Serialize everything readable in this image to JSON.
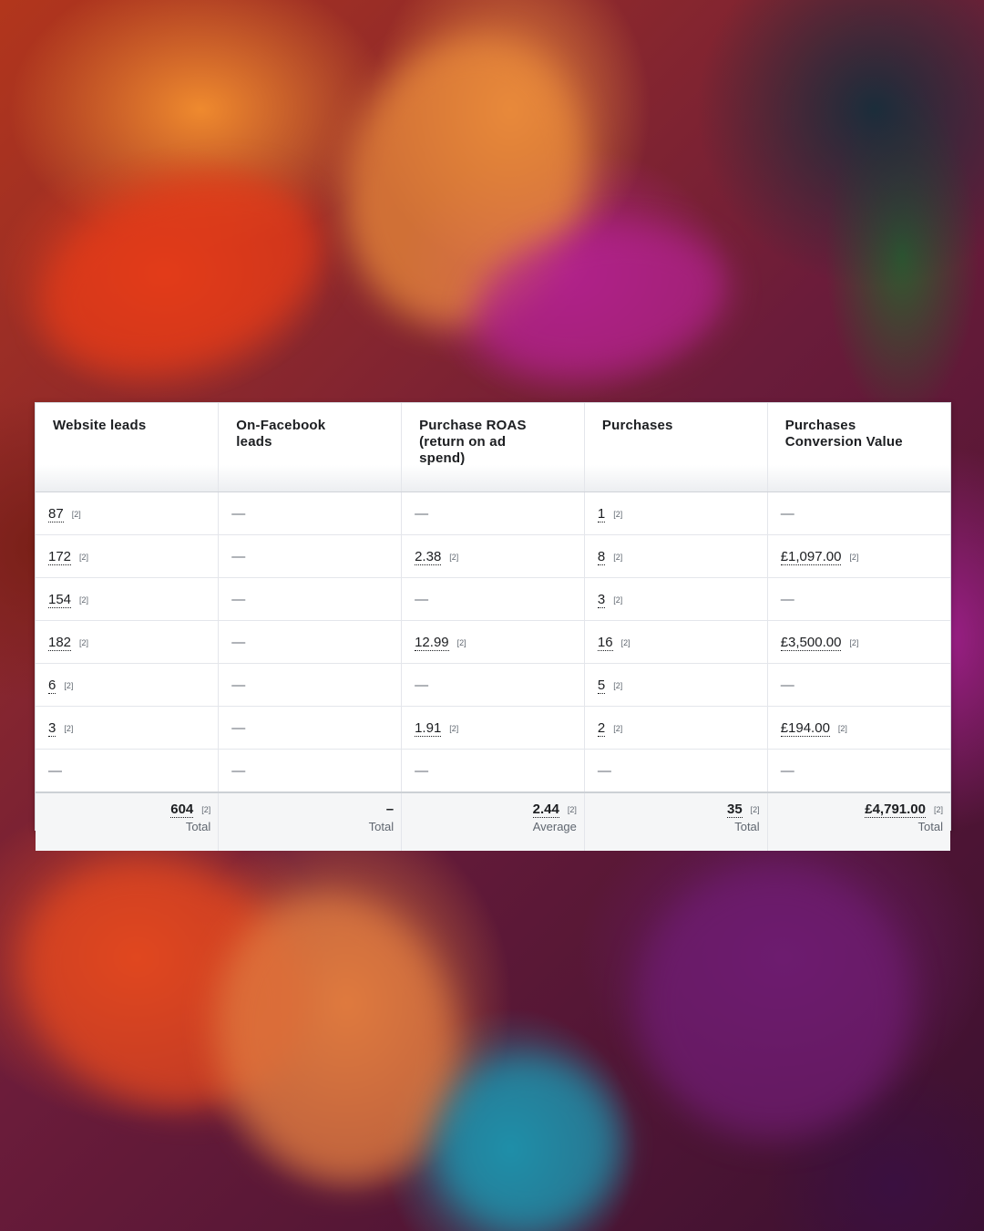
{
  "table": {
    "headers": [
      {
        "line1": "Website leads",
        "line2": "",
        "line3": ""
      },
      {
        "line1": "On-Facebook",
        "line2": "leads",
        "line3": ""
      },
      {
        "line1": "Purchase ROAS",
        "line2": "(return on ad",
        "line3": "spend)"
      },
      {
        "line1": "Purchases",
        "line2": "",
        "line3": ""
      },
      {
        "line1": "Purchases",
        "line2": "Conversion Value",
        "line3": ""
      }
    ],
    "note": "[2]",
    "dash": "—",
    "rows": [
      [
        "87",
        "—",
        "—",
        "1",
        "—"
      ],
      [
        "172",
        "—",
        "2.38",
        "8",
        "£1,097.00"
      ],
      [
        "154",
        "—",
        "—",
        "3",
        "—"
      ],
      [
        "182",
        "—",
        "12.99",
        "16",
        "£3,500.00"
      ],
      [
        "6",
        "—",
        "—",
        "5",
        "—"
      ],
      [
        "3",
        "—",
        "1.91",
        "2",
        "£194.00"
      ],
      [
        "—",
        "—",
        "—",
        "—",
        "—"
      ]
    ],
    "totals": [
      {
        "value": "604",
        "label": "Total"
      },
      {
        "value": "–",
        "label": "Total"
      },
      {
        "value": "2.44",
        "label": "Average"
      },
      {
        "value": "35",
        "label": "Total"
      },
      {
        "value": "£4,791.00",
        "label": "Total"
      }
    ]
  }
}
